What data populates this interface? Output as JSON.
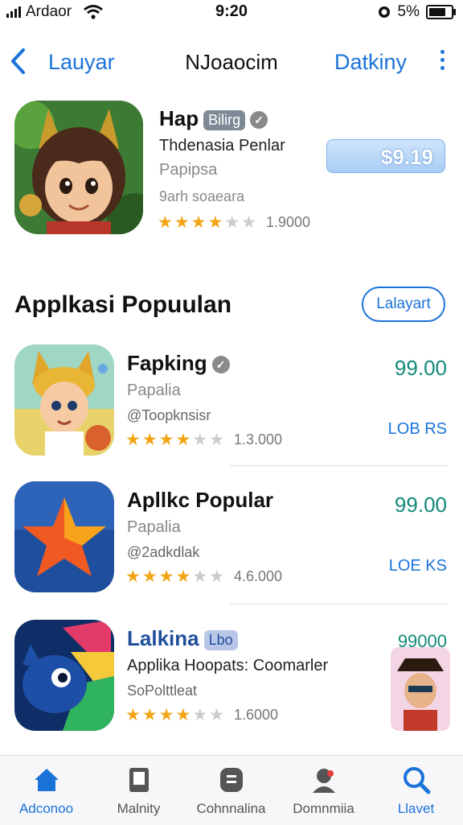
{
  "status": {
    "carrier": "Ardaor",
    "time": "9:20",
    "battery": "5%"
  },
  "nav": {
    "back_label": "Lauyar",
    "title": "NJoaocim",
    "action_label": "Datkiny"
  },
  "featured": {
    "name": "Hap",
    "chip": "Bilirg",
    "subtitle": "Thdenasia Penlar",
    "category": "Papipsa",
    "developer": "9arh soaeara",
    "rating_stars": 3.5,
    "rating_count": "1.9000",
    "price": "$9.19"
  },
  "section": {
    "title": "Applkasi Popuulan",
    "see_all": "Lalayart"
  },
  "apps": [
    {
      "name": "Fapking",
      "category": "Papalia",
      "developer": "@Toopknsisr",
      "rating_stars": 4,
      "rating_count": "1.3.000",
      "price": "99.00",
      "get_label": "LOB RS"
    },
    {
      "name": "Apllkc Popular",
      "category": "Papalia",
      "developer": "@2adkdlak",
      "rating_stars": 4,
      "rating_count": "4.6.000",
      "price": "99.00",
      "get_label": "LOE KS"
    },
    {
      "name": "Lalkina",
      "chip": "Lbo",
      "subtitle": "Applika Hoopats: Coomarler",
      "developer": "SoPolttleat",
      "rating_stars": 3.5,
      "rating_count": "1.6000",
      "price": "99000"
    }
  ],
  "tabs": [
    {
      "label": "Adconoo",
      "icon": "home-icon"
    },
    {
      "label": "Malnity",
      "icon": "document-icon"
    },
    {
      "label": "Cohnnalina",
      "icon": "apps-icon"
    },
    {
      "label": "Domnmiia",
      "icon": "person-icon"
    },
    {
      "label": "Llavet",
      "icon": "search-icon"
    }
  ],
  "colors": {
    "accent": "#1a73d9",
    "price_green": "#138a7a",
    "star": "#f2a516"
  }
}
